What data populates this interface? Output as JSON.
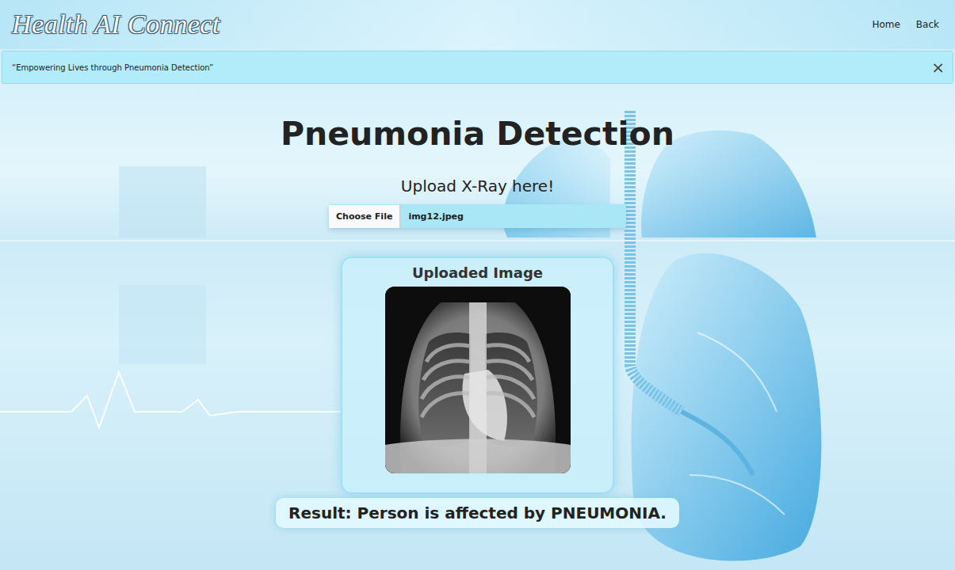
{
  "header": {
    "logo": "Health AI Connect",
    "nav": [
      {
        "label": "Home"
      },
      {
        "label": "Back"
      }
    ]
  },
  "banner": {
    "text": "“Empowering Lives through Pneumonia Detection”",
    "close": "×"
  },
  "title": "Pneumonia Detection",
  "upload": {
    "label": "Upload X-Ray here!",
    "button": "Choose File",
    "filename": "img12.jpeg"
  },
  "preview": {
    "title": "Uploaded Image"
  },
  "result": "Result: Person is affected by PNEUMONIA."
}
